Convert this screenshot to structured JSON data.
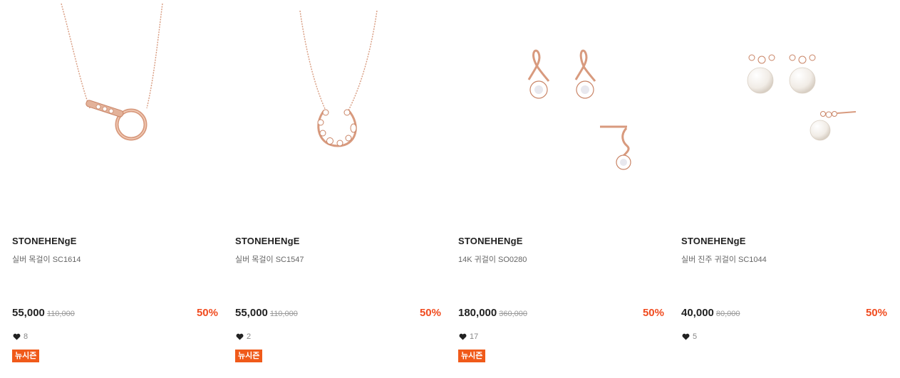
{
  "products": [
    {
      "brand": "STONEHENgE",
      "name": "실버 목걸이 SC1614",
      "price": "55,000",
      "original_price": "110,000",
      "discount": "50%",
      "likes": "8",
      "badge": "뉴시즌",
      "image_icon": "circle-pendant-necklace-icon"
    },
    {
      "brand": "STONEHENgE",
      "name": "실버 목걸이 SC1547",
      "price": "55,000",
      "original_price": "110,000",
      "discount": "50%",
      "likes": "2",
      "badge": "뉴시즌",
      "image_icon": "horseshoe-pendant-necklace-icon"
    },
    {
      "brand": "STONEHENgE",
      "name": "14K 귀걸이 SO0280",
      "price": "180,000",
      "original_price": "360,000",
      "discount": "50%",
      "likes": "17",
      "badge": "뉴시즌",
      "image_icon": "knot-drop-earrings-icon"
    },
    {
      "brand": "STONEHENgE",
      "name": "실버 진주 귀걸이 SC1044",
      "price": "40,000",
      "original_price": "80,000",
      "discount": "50%",
      "likes": "5",
      "image_icon": "pearl-earrings-icon"
    }
  ],
  "colors": {
    "discount": "#f04b1f",
    "badge": "#f05a1a",
    "rose_gold": "#d89a7e"
  }
}
